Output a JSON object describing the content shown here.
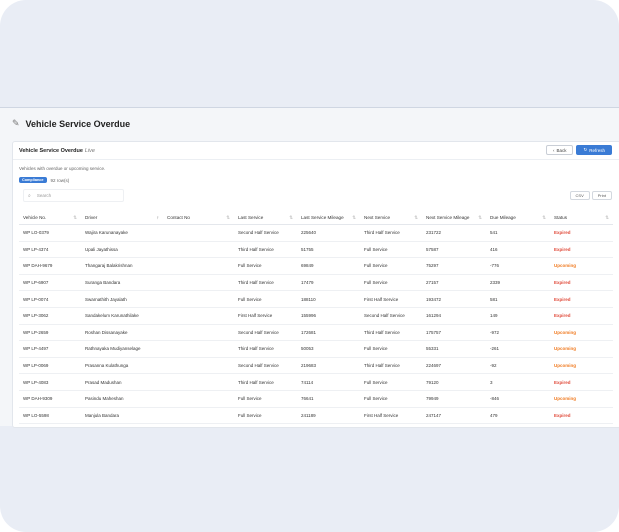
{
  "page": {
    "title": "Vehicle Service Overdue"
  },
  "card": {
    "title": "Vehicle Service Overdue",
    "live": "Live",
    "subtitle": "Vehicles with overdue or upcoming service.",
    "badge": "Compliance",
    "row_count": "92 row(s)",
    "back_label": "Back",
    "refresh_label": "Refresh",
    "search_placeholder": "Search",
    "csv_label": "CSV",
    "print_label": "Print"
  },
  "colors": {
    "accent": "#3a7bd5",
    "expired": "#e04a3a",
    "upcoming": "#f07a20"
  },
  "icons": {
    "title": "pencil-icon",
    "back": "chevron-left-icon",
    "refresh": "refresh-icon",
    "search": "search-icon"
  },
  "table": {
    "columns": [
      "Vehicle No.",
      "Driver",
      "Contact No",
      "Last Service",
      "Last Service Mileage",
      "Next Service",
      "Next Service Mileage",
      "Due Mileage",
      "Status"
    ],
    "rows": [
      [
        "WP LO-0379",
        "Wajira Karunanayake",
        "",
        "Second Half Service",
        "225640",
        "Third Half Service",
        "231722",
        "541",
        "Expired"
      ],
      [
        "WP LP-4374",
        "Upali Jayathissa",
        "",
        "Third Half Service",
        "51755",
        "Full Service",
        "57587",
        "416",
        "Expired"
      ],
      [
        "WP DAH-9679",
        "Thangaraj Balakrishnan",
        "",
        "Full Service",
        "69849",
        "Full Service",
        "75297",
        "-776",
        "Upcoming"
      ],
      [
        "WP LP-6907",
        "Suranga Bandara",
        "",
        "Third Half Service",
        "17479",
        "Full Service",
        "27157",
        "2339",
        "Expired"
      ],
      [
        "WP LP-0074",
        "Swarnathith Jayalath",
        "",
        "Full Service",
        "188110",
        "First Half Service",
        "193472",
        "581",
        "Expired"
      ],
      [
        "WP LP-3062",
        "Sandakelum Karunathilake",
        "",
        "First Half Service",
        "155996",
        "Second Half Service",
        "161294",
        "149",
        "Expired"
      ],
      [
        "WP LP-2659",
        "Roshan Dissanayake",
        "",
        "Second Half Service",
        "172681",
        "Third Half Service",
        "175757",
        "-972",
        "Upcoming"
      ],
      [
        "WP LP-4497",
        "Rathnayaka Mudiyanselage",
        "",
        "Third Half Service",
        "50053",
        "Full Service",
        "55331",
        "-261",
        "Upcoming"
      ],
      [
        "WP LP-0069",
        "Prasanna Kulathunga",
        "",
        "Second Half Service",
        "219683",
        "Third Half Service",
        "224697",
        "-92",
        "Upcoming"
      ],
      [
        "WP LP-4083",
        "Prasad Madushan",
        "",
        "Third Half Service",
        "74114",
        "Full Service",
        "79120",
        "3",
        "Expired"
      ],
      [
        "WP DAH-9309",
        "Pasindu Maheshan",
        "",
        "Full Service",
        "76641",
        "Full Service",
        "79949",
        "-846",
        "Upcoming"
      ],
      [
        "WP LO-5598",
        "Manjula Bandara",
        "",
        "Full Service",
        "241189",
        "First Half Service",
        "247147",
        "479",
        "Expired"
      ],
      [
        "KE UO-6077",
        "Kalupahana Jayawardana",
        "",
        "Full Service",
        "70932",
        "First Service",
        "75601",
        "102",
        "Expired"
      ]
    ]
  }
}
